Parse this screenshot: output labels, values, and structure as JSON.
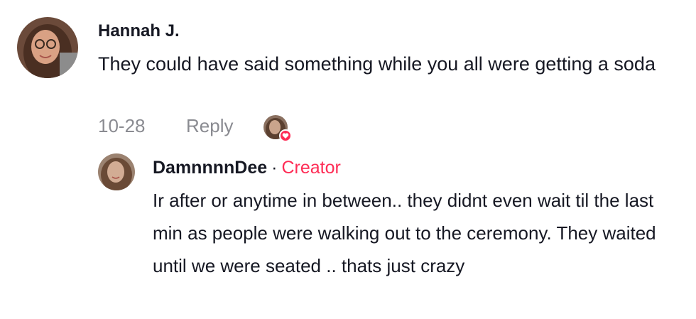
{
  "comment": {
    "author": "Hannah J.",
    "text": "They could have said something while you all were getting a soda",
    "date": "10-28",
    "reply_label": "Reply"
  },
  "reply": {
    "author": "DamnnnnDee",
    "separator": "·",
    "badge": "Creator",
    "text": "Ir after or anytime in between.. they didnt even wait til the last min as people were walking out to the ceremony. They waited until we were seated .. thats just crazy"
  },
  "colors": {
    "accent": "#fe2c55",
    "muted": "#8a8b91",
    "text": "#161823"
  },
  "icons": {
    "liked_badge": "heart-icon"
  }
}
